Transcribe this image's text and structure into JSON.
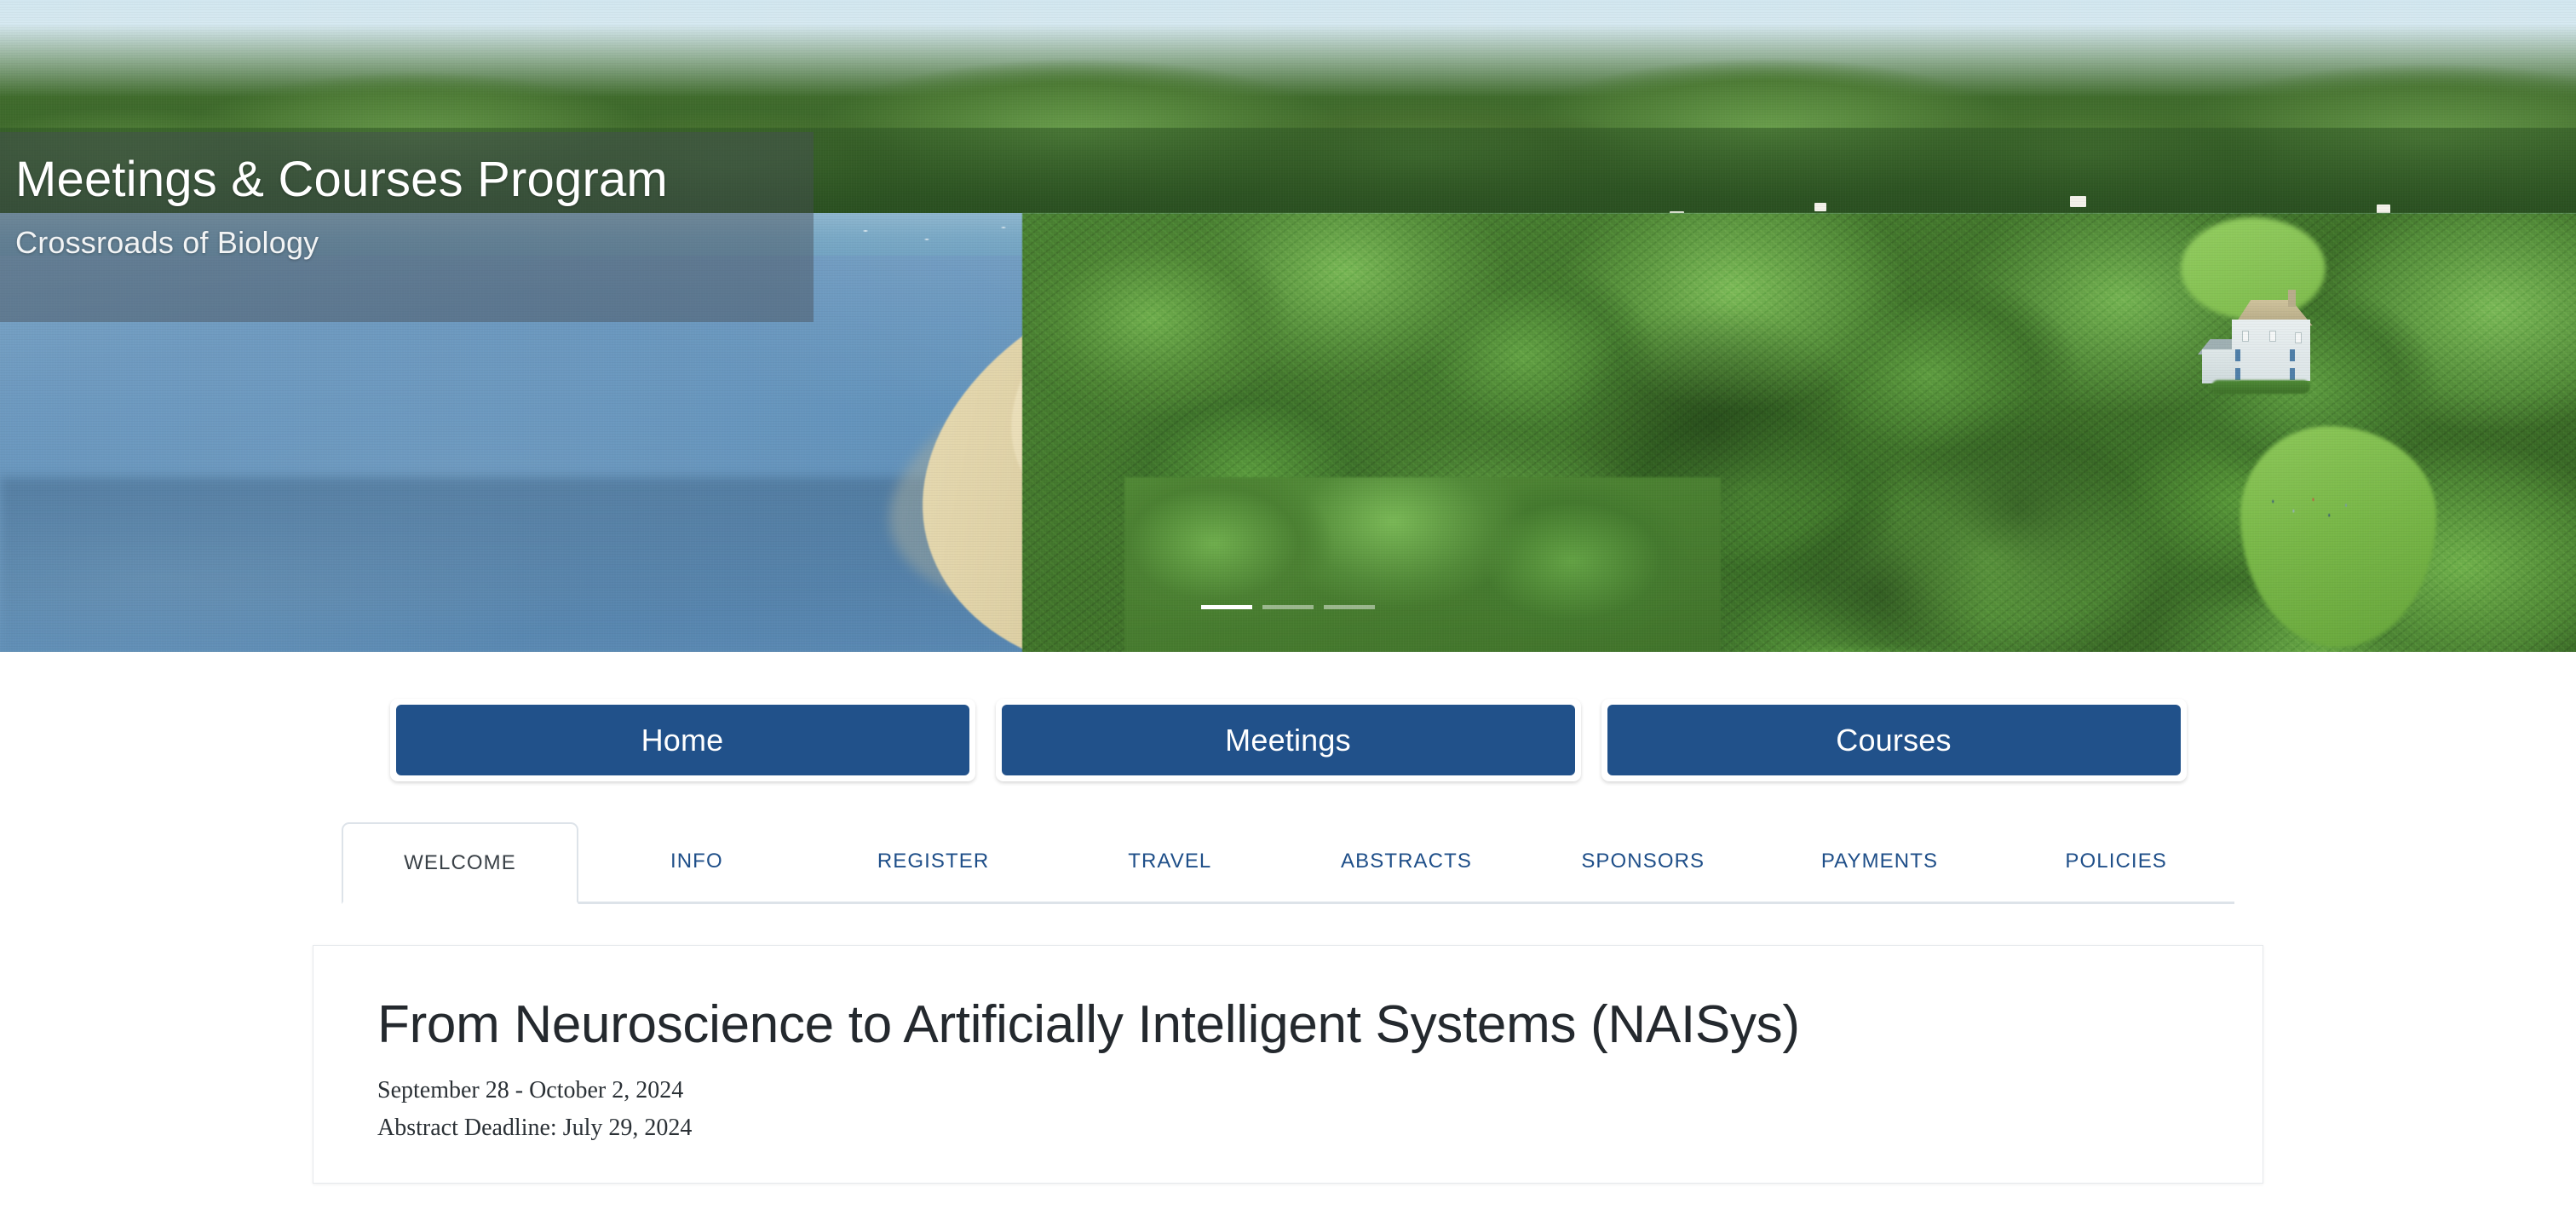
{
  "hero": {
    "title": "Meetings & Courses Program",
    "subtitle": "Crossroads of Biology",
    "image_alt": "aerial-view-of-cold-spring-harbor",
    "carousel": {
      "slide_count": 3,
      "active_index": 0,
      "slides": [
        "slide-1",
        "slide-2",
        "slide-3"
      ]
    }
  },
  "main_nav": {
    "buttons": [
      {
        "label": "Home"
      },
      {
        "label": "Meetings"
      },
      {
        "label": "Courses"
      }
    ]
  },
  "tabs": {
    "active": "WELCOME",
    "items": [
      {
        "label": "WELCOME"
      },
      {
        "label": "INFO"
      },
      {
        "label": "REGISTER"
      },
      {
        "label": "TRAVEL"
      },
      {
        "label": "ABSTRACTS"
      },
      {
        "label": "SPONSORS"
      },
      {
        "label": "PAYMENTS"
      },
      {
        "label": "POLICIES"
      }
    ]
  },
  "content": {
    "title": "From Neuroscience to Artificially Intelligent Systems (NAISys)",
    "dates": "September 28 - October 2, 2024",
    "abstract_deadline": "Abstract Deadline: July 29, 2024"
  },
  "colors": {
    "brand_blue": "#21518a",
    "link_blue": "#1f4f89",
    "tab_active_text": "#3a4147",
    "heading": "#24292e",
    "border": "#dde3e9",
    "card_border": "#e6e9ec"
  }
}
